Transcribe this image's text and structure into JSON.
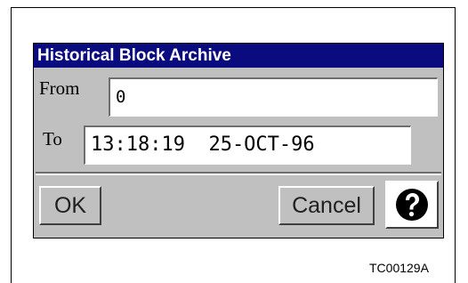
{
  "dialog": {
    "title": "Historical Block Archive",
    "from_label": "From",
    "from_value": "0",
    "to_label": "To",
    "to_value": "13:18:19  25-OCT-96",
    "ok_label": "OK",
    "cancel_label": "Cancel",
    "help_icon": "question-circle-icon"
  },
  "figure_id": "TC00129A",
  "colors": {
    "title_bar": "#0b0b80",
    "dialog_bg": "#c0c0c0"
  }
}
